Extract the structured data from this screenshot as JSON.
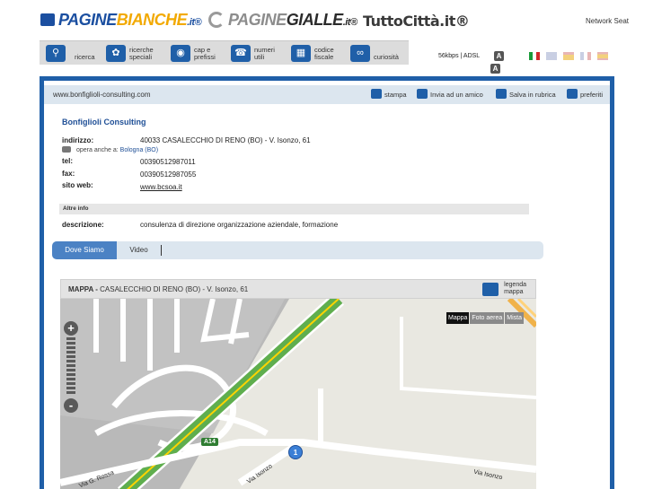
{
  "brands": {
    "paginebianche": {
      "main": "PAGINE",
      "hl": "BIANCHE",
      "suffix": ".it®"
    },
    "paginegialle": {
      "main": "PAGINE",
      "hl": "GIALLE",
      "suffix": ".it®"
    },
    "tuttocitta": "TuttoCittà.it®",
    "network_seat": "Network Seat"
  },
  "toolbar": {
    "items": [
      {
        "label1": "ricerca",
        "label2": ""
      },
      {
        "label1": "ricerche",
        "label2": "speciali"
      },
      {
        "label1": "cap e",
        "label2": "prefissi"
      },
      {
        "label1": "numeri",
        "label2": "utili"
      },
      {
        "label1": "codice",
        "label2": "fiscale"
      },
      {
        "label1": "curiosità",
        "label2": ""
      }
    ],
    "bandwidth": "56kbps | ADSL",
    "adsl_a": "A"
  },
  "colors": {
    "accent": "#1f5fa8",
    "tab_active": "#4b82c4",
    "brand_hl": "#f2a900"
  },
  "listing": {
    "url": "www.bonfiglioli-consulting.com",
    "actions": {
      "stampa": "stampa",
      "invia": "Invia ad un amico",
      "salva": "Salva in rubrica",
      "preferiti": "preferiti"
    },
    "name": "Bonfiglioli Consulting",
    "labels": {
      "indirizzo": "indirizzo:",
      "tel": "tel:",
      "fax": "fax:",
      "sito": "sito web:",
      "descrizione": "descrizione:"
    },
    "address": "40033 CASALECCHIO DI RENO (BO) - V. Isonzo, 61",
    "also_prefix": "opera anche a:",
    "also_city": "Bologna (BO)",
    "tel": "00390512987011",
    "fax": "00390512987055",
    "website": "www.bcsoa.it",
    "altre_info": "Altre info",
    "description": "consulenza di direzione organizzazione aziendale, formazione"
  },
  "tabs": {
    "active": "Dove Siamo",
    "video": "Video"
  },
  "map": {
    "title_bold": "MAPPA -",
    "title_rest": "CASALECCHIO DI RENO (BO) - V. Isonzo, 61",
    "legend1": "legenda",
    "legend2": "mappa",
    "types": [
      "Mappa",
      "Foto aerea",
      "Mista"
    ],
    "zoom_in": "+",
    "zoom_out": "-",
    "roads": {
      "rossa": "Via G. Rossa",
      "isonzo1": "Via Isonzo",
      "isonzo2": "Via Isonzo",
      "a14": "A14"
    },
    "marker": "1"
  }
}
